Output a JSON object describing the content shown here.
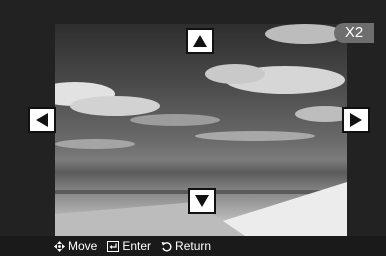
{
  "viewer": {
    "zoom_label": "X2",
    "navigation": {
      "up_icon": "arrow-up-icon",
      "down_icon": "arrow-down-icon",
      "left_icon": "arrow-left-icon",
      "right_icon": "arrow-right-icon"
    }
  },
  "help_bar": {
    "move": {
      "icon": "move-icon",
      "label": "Move"
    },
    "enter": {
      "icon": "enter-icon",
      "label": "Enter"
    },
    "return": {
      "icon": "return-icon",
      "label": "Return"
    }
  }
}
